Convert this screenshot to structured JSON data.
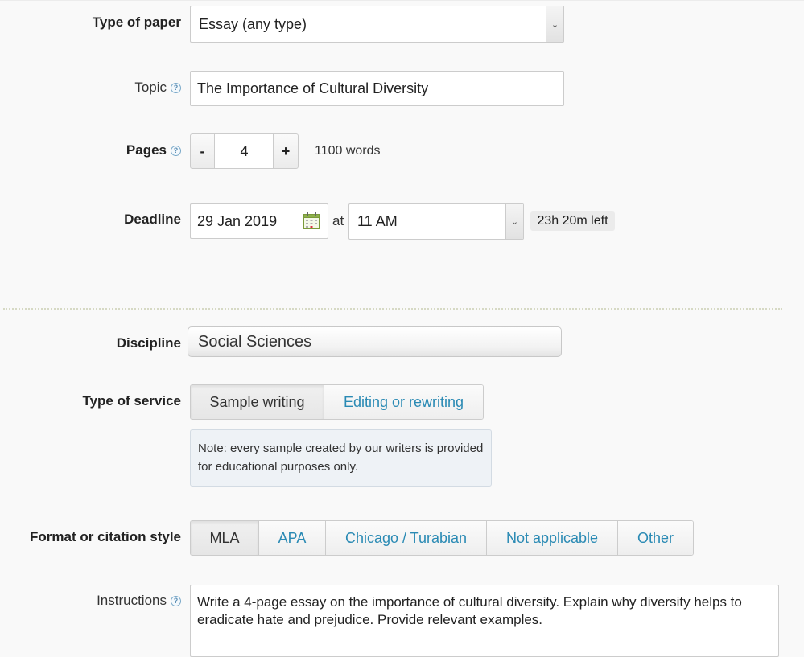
{
  "form": {
    "paper_type": {
      "label": "Type of paper",
      "value": "Essay (any type)"
    },
    "topic": {
      "label": "Topic",
      "value": "The Importance of Cultural Diversity"
    },
    "pages": {
      "label": "Pages",
      "minus": "-",
      "value": "4",
      "plus": "+",
      "words": "1100 words"
    },
    "deadline": {
      "label": "Deadline",
      "date": "29 Jan 2019",
      "at": "at",
      "time": "11 AM",
      "left": "23h 20m left"
    },
    "discipline": {
      "label": "Discipline",
      "value": "Social Sciences"
    },
    "service": {
      "label": "Type of service",
      "options": [
        "Sample writing",
        "Editing or rewriting"
      ],
      "selected": "Sample writing",
      "note": "Note: every sample created by our writers is provided for educational purposes only."
    },
    "format": {
      "label": "Format or citation style",
      "options": [
        "MLA",
        "APA",
        "Chicago / Turabian",
        "Not applicable",
        "Other"
      ],
      "selected": "MLA"
    },
    "instructions": {
      "label": "Instructions",
      "value": "Write a 4-page essay on the importance of cultural diversity. Explain why diversity helps to eradicate hate and prejudice. Provide relevant examples."
    }
  },
  "icons": {
    "help": "help-icon",
    "calendar": "calendar-icon",
    "dropdown": "chevron-down-icon"
  },
  "colors": {
    "link": "#2a8ab4",
    "background": "#f9f9f9",
    "note_bg": "#eef2f6",
    "badge_bg": "#ebebeb"
  }
}
